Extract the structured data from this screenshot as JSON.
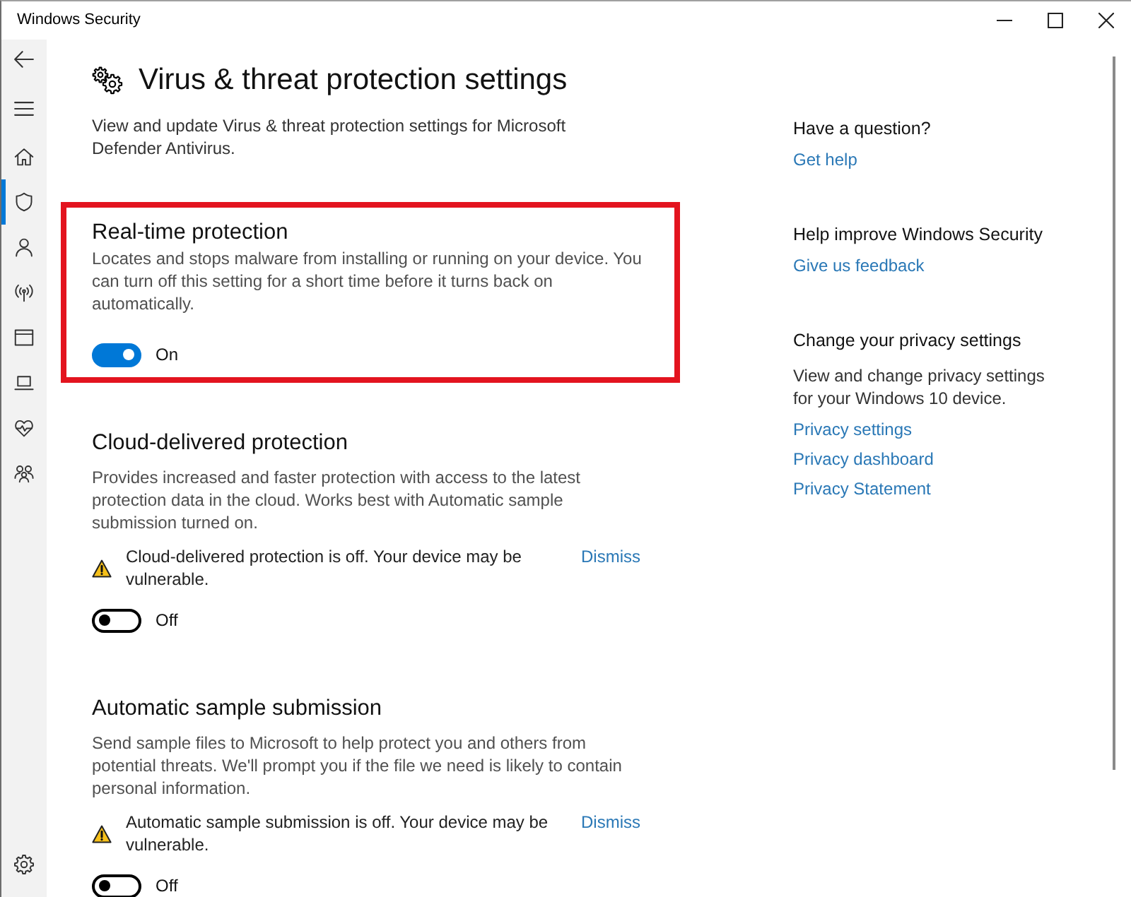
{
  "window": {
    "title": "Windows Security"
  },
  "sidebar": {
    "items": [
      {
        "selected": false
      },
      {
        "selected": true
      },
      {
        "selected": false
      },
      {
        "selected": false
      },
      {
        "selected": false
      },
      {
        "selected": false
      },
      {
        "selected": false
      },
      {
        "selected": false
      }
    ]
  },
  "page": {
    "title": "Virus & threat protection settings",
    "description": "View and update Virus & threat protection settings for Microsoft Defender Antivirus."
  },
  "settings": [
    {
      "title": "Real-time protection",
      "description": "Locates and stops malware from installing or running on your device. You can turn off this setting for a short time before it turns back on automatically.",
      "highlighted": true,
      "toggle": {
        "on": true,
        "label": "On"
      }
    },
    {
      "title": "Cloud-delivered protection",
      "description": "Provides increased and faster protection with access to the latest protection data in the cloud. Works best with Automatic sample submission turned on.",
      "highlighted": false,
      "warning": {
        "text": "Cloud-delivered protection is off. Your device may be vulnerable.",
        "action": "Dismiss"
      },
      "toggle": {
        "on": false,
        "label": "Off"
      }
    },
    {
      "title": "Automatic sample submission",
      "description": "Send sample files to Microsoft to help protect you and others from potential threats. We'll prompt you if the file we need is likely to contain personal information.",
      "highlighted": false,
      "warning": {
        "text": "Automatic sample submission is off. Your device may be vulnerable.",
        "action": "Dismiss"
      },
      "toggle": {
        "on": false,
        "label": "Off"
      }
    }
  ],
  "side_panel": {
    "sections": [
      {
        "heading": "Have a question?",
        "links": [
          "Get help"
        ]
      },
      {
        "heading": "Help improve Windows Security",
        "links": [
          "Give us feedback"
        ]
      },
      {
        "heading": "Change your privacy settings",
        "description": "View and change privacy settings for your Windows 10 device.",
        "links": [
          "Privacy settings",
          "Privacy dashboard",
          "Privacy Statement"
        ]
      }
    ]
  }
}
